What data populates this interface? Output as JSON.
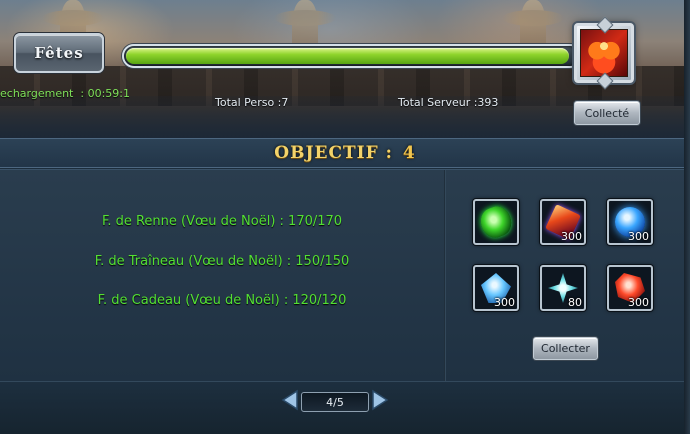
{
  "header": {
    "tab_label": "Fêtes",
    "reload_text": "echargement  : 00:59:1",
    "total_perso": "Total Perso :7",
    "total_serveur": "Total Serveur :393",
    "progress_fraction": 0.98,
    "collected_label": "Collecté",
    "reward_icon": "gift-box-icon"
  },
  "objective": {
    "title": "Objectif :",
    "number": "4"
  },
  "requirements": [
    "F. de Renne (Vœu de Noël) : 170/170",
    "F. de Traîneau (Vœu de Noël) : 150/150",
    "F. de Cadeau (Vœu de Noël) : 120/120"
  ],
  "rewards": [
    {
      "icon": "green-gem-icon",
      "qty": ""
    },
    {
      "icon": "fire-scroll-icon",
      "qty": "300"
    },
    {
      "icon": "blue-orb-icon",
      "qty": "300"
    },
    {
      "icon": "blue-crystal-icon",
      "qty": "300"
    },
    {
      "icon": "teal-star-icon",
      "qty": "80"
    },
    {
      "icon": "red-crystal-icon",
      "qty": "300"
    }
  ],
  "collect_button": "Collecter",
  "pagination": {
    "label": "4/5"
  },
  "colors": {
    "requirement_text": "#53e033",
    "objective_gold": "#f3d36a",
    "progress_green": "#8fd52c"
  }
}
